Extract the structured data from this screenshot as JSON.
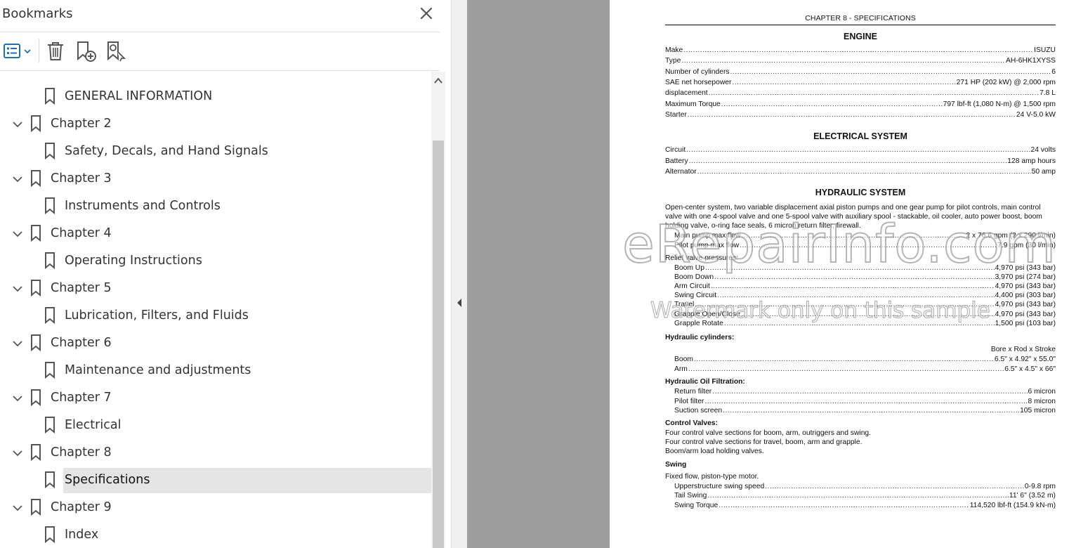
{
  "bookmarks_panel": {
    "title": "Bookmarks",
    "items": [
      {
        "label": "GENERAL INFORMATION",
        "level": 2,
        "expandable": false,
        "selected": false
      },
      {
        "label": "Chapter 2",
        "level": 1,
        "expandable": true,
        "selected": false
      },
      {
        "label": "Safety, Decals, and Hand Signals",
        "level": 2,
        "expandable": false,
        "selected": false
      },
      {
        "label": "Chapter 3",
        "level": 1,
        "expandable": true,
        "selected": false
      },
      {
        "label": "Instruments and Controls",
        "level": 2,
        "expandable": false,
        "selected": false
      },
      {
        "label": "Chapter 4",
        "level": 1,
        "expandable": true,
        "selected": false
      },
      {
        "label": "Operating Instructions",
        "level": 2,
        "expandable": false,
        "selected": false
      },
      {
        "label": "Chapter 5",
        "level": 1,
        "expandable": true,
        "selected": false
      },
      {
        "label": "Lubrication, Filters, and Fluids",
        "level": 2,
        "expandable": false,
        "selected": false
      },
      {
        "label": "Chapter 6",
        "level": 1,
        "expandable": true,
        "selected": false
      },
      {
        "label": "Maintenance and adjustments",
        "level": 2,
        "expandable": false,
        "selected": false
      },
      {
        "label": "Chapter 7",
        "level": 1,
        "expandable": true,
        "selected": false
      },
      {
        "label": "Electrical",
        "level": 2,
        "expandable": false,
        "selected": false
      },
      {
        "label": "Chapter 8",
        "level": 1,
        "expandable": true,
        "selected": false
      },
      {
        "label": "Specifications",
        "level": 2,
        "expandable": false,
        "selected": true
      },
      {
        "label": "Chapter 9",
        "level": 1,
        "expandable": true,
        "selected": false
      },
      {
        "label": "Index",
        "level": 2,
        "expandable": false,
        "selected": false
      }
    ]
  },
  "icons": {
    "close": "close-icon",
    "options": "bookmark-options-icon",
    "delete": "trash-icon",
    "add": "add-bookmark-icon",
    "find": "find-bookmark-icon",
    "bookmark": "bookmark-icon",
    "expand": "chevron-down-icon",
    "collapse_panel": "chevron-left-icon"
  },
  "colors": {
    "accent": "#1f6fb5",
    "selected_bg": "#e4e4e4",
    "gutter": "#9e9e9e"
  },
  "document": {
    "chapter_header": "CHAPTER 8 - SPECIFICATIONS",
    "engine": {
      "title": "ENGINE",
      "rows": [
        {
          "k": "Make",
          "v": "ISUZU"
        },
        {
          "k": "Type",
          "v": "AH-6HK1XYSS"
        },
        {
          "k": "Number of cylinders",
          "v": "6"
        },
        {
          "k": "SAE net horsepower",
          "v": "271 HP (202 kW) @ 2,000 rpm"
        },
        {
          "k": "displacement",
          "v": "7.8 L"
        },
        {
          "k": "Maximum Torque",
          "v": "797 lbf-ft (1,080 N-m) @ 1,500 rpm"
        },
        {
          "k": "Starter",
          "v": "24 V-5.0 kW"
        }
      ]
    },
    "electrical": {
      "title": "ELECTRICAL SYSTEM",
      "rows": [
        {
          "k": "Circuit",
          "v": "24 volts"
        },
        {
          "k": "Battery",
          "v": "128 amp hours"
        },
        {
          "k": "Alternator",
          "v": "50 amp"
        }
      ]
    },
    "hydraulic": {
      "title": "HYDRAULIC SYSTEM",
      "description": "Open-center system, two variable displacement axial piston pumps and one gear pump for pilot controls, main control valve with one 4-spool valve and one 5-spool valve with auxiliary spool - stackable, oil cooler, auto power boost, boom holding valve, o-ring face seals, 6 micron return filter, firewall.",
      "pump_rows": [
        {
          "k": "Main pump max flow",
          "v": "2 x 76.6 gpm (2 x 290 l/min)"
        },
        {
          "k": "Pilot pump max flow",
          "v": "7.9 gpm (30 l/min)"
        }
      ],
      "relief_label": "Relief valve pressures:",
      "relief_rows": [
        {
          "k": "Boom Up",
          "v": "4,970 psi (343 bar)"
        },
        {
          "k": "Boom Down",
          "v": "3,970 psi (274 bar)"
        },
        {
          "k": "Arm Circuit",
          "v": "4,970 psi (343 bar)"
        },
        {
          "k": "Swing Circuit",
          "v": "4,400 psi (303 bar)"
        },
        {
          "k": "Travel",
          "v": "4,970 psi (343 bar)"
        },
        {
          "k": "Grapple Open/Close",
          "v": "4,970 psi (343 bar)"
        },
        {
          "k": "Grapple Rotate",
          "v": "1,500 psi (103 bar)"
        }
      ],
      "cylinders_label": "Hydraulic cylinders:",
      "cylinders_header": "Bore x Rod x Stroke",
      "cylinder_rows": [
        {
          "k": "Boom",
          "v": "6.5\" x 4.92\" x 55.0\""
        },
        {
          "k": "Arm",
          "v": "6.5\" x 4.5\" x 66\""
        }
      ],
      "filtration_label": "Hydraulic Oil Filtration:",
      "filtration_rows": [
        {
          "k": "Return filter",
          "v": "6 micron"
        },
        {
          "k": "Pilot filter",
          "v": "8 micron"
        },
        {
          "k": "Suction screen",
          "v": "105 micron"
        }
      ],
      "control_label": "Control Valves:",
      "control_lines": [
        "Four control valve sections for boom, arm, outriggers and swing.",
        "Four control valve sections for travel, boom, arm and grapple.",
        "Boom/arm load holding valves."
      ],
      "swing_label": "Swing",
      "swing_line": "Fixed flow, piston-type motor.",
      "swing_rows": [
        {
          "k": "Upperstructure swing speed",
          "v": "0-9.8 rpm"
        },
        {
          "k": "Tail Swing",
          "v": "11' 6\" (3.52 m)"
        },
        {
          "k": "Swing Torque",
          "v": "114,520 lbf-ft (154.9 kN-m)"
        }
      ]
    },
    "watermark_big": "eRepairInfo.com",
    "watermark_small": "Watermark only on this sample"
  }
}
